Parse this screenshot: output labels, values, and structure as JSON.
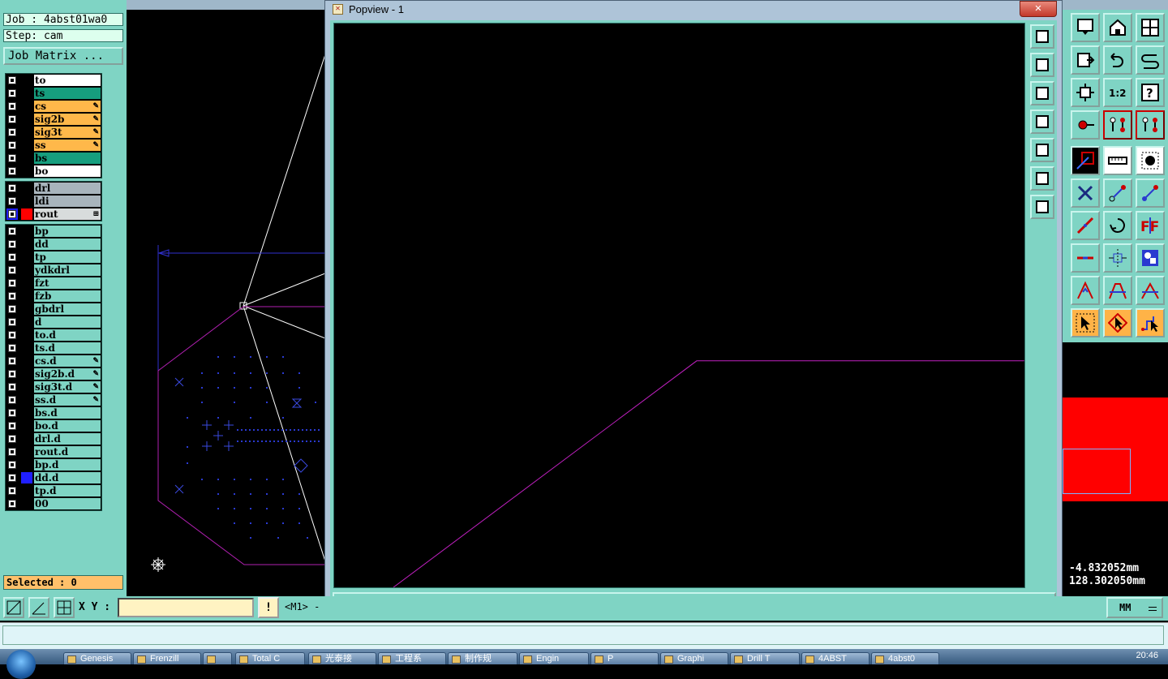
{
  "left_panel": {
    "job": "Job : 4abst01wa0",
    "step": "Step: cam",
    "job_matrix": "Job Matrix ...",
    "board_layers": [
      {
        "name": "to",
        "bg": "#ffffff",
        "mark": ""
      },
      {
        "name": "ts",
        "bg": "#169e7e",
        "mark": ""
      },
      {
        "name": "cs",
        "bg": "#ffb84a",
        "mark": "✎"
      },
      {
        "name": "sig2b",
        "bg": "#ffb84a",
        "mark": "✎"
      },
      {
        "name": "sig3t",
        "bg": "#ffb84a",
        "mark": "✎"
      },
      {
        "name": "ss",
        "bg": "#ffb84a",
        "mark": "✎"
      },
      {
        "name": "bs",
        "bg": "#169e7e",
        "mark": ""
      },
      {
        "name": "bo",
        "bg": "#ffffff",
        "mark": ""
      }
    ],
    "drill_layers": [
      {
        "name": "drl",
        "bg": "#a8b4bc",
        "mark": ""
      },
      {
        "name": "ldi",
        "bg": "#a8b4bc",
        "mark": ""
      },
      {
        "name": "rout",
        "bg": "#d8dcdc",
        "mark": "⊞",
        "swatch": "#ff0000",
        "active": true
      }
    ],
    "misc_layers": [
      {
        "name": "bp",
        "mark": ""
      },
      {
        "name": "dd",
        "mark": ""
      },
      {
        "name": "tp",
        "mark": ""
      },
      {
        "name": "ydkdrl",
        "mark": ""
      },
      {
        "name": "fzt",
        "mark": ""
      },
      {
        "name": "fzb",
        "mark": ""
      },
      {
        "name": "gbdrl",
        "mark": ""
      },
      {
        "name": "d",
        "mark": ""
      },
      {
        "name": "to.d",
        "mark": ""
      },
      {
        "name": "ts.d",
        "mark": ""
      },
      {
        "name": "cs.d",
        "mark": "✎"
      },
      {
        "name": "sig2b.d",
        "mark": "✎"
      },
      {
        "name": "sig3t.d",
        "mark": "✎"
      },
      {
        "name": "ss.d",
        "mark": "✎"
      },
      {
        "name": "bs.d",
        "mark": ""
      },
      {
        "name": "bo.d",
        "mark": ""
      },
      {
        "name": "drl.d",
        "mark": ""
      },
      {
        "name": "rout.d",
        "mark": ""
      },
      {
        "name": "bp.d",
        "mark": ""
      },
      {
        "name": "dd.d",
        "mark": "",
        "swatch": "#1f1fff"
      },
      {
        "name": "tp.d",
        "mark": ""
      },
      {
        "name": "00",
        "mark": ""
      }
    ],
    "selected": "Selected : 0"
  },
  "popup": {
    "title": "Popview - 1",
    "close_x": "✕",
    "close_button": "Close"
  },
  "coords": {
    "x": "-4.832052mm",
    "y": "128.302050mm"
  },
  "bottom_bar": {
    "xy_label": "X Y :",
    "xy_value": "",
    "excl": "!",
    "m1": "<M1> -",
    "units": "MM"
  },
  "taskbar": {
    "items": [
      "Genesis",
      "Frenzill",
      "",
      "Total C",
      "光泰接",
      "工程系",
      "制作规",
      "Engin",
      "P",
      "Graphi",
      "Drill T",
      "4ABST",
      "4abst0"
    ],
    "clock": "20:46"
  },
  "colors": {
    "teal": "#7fd4c4",
    "popup_trace": "#c020c0"
  }
}
